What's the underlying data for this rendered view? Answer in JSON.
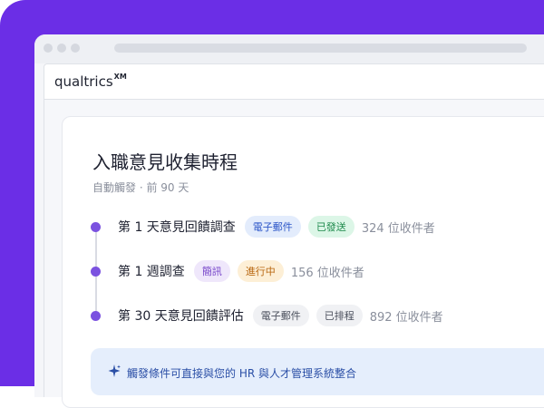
{
  "app": {
    "logo_text": "qualtrics",
    "logo_mark": "XM"
  },
  "card": {
    "title": "入職意見收集時程",
    "subtitle": "自動觸發 · 前 90 天"
  },
  "steps": [
    {
      "label": "第 1 天意見回饋調查",
      "tags": [
        {
          "text": "電子郵件",
          "style": "blue"
        },
        {
          "text": "已發送",
          "style": "green"
        }
      ],
      "count": "324 位收件者"
    },
    {
      "label": "第 1 週調查",
      "tags": [
        {
          "text": "簡訊",
          "style": "purple"
        },
        {
          "text": "進行中",
          "style": "orange"
        }
      ],
      "count": "156 位收件者"
    },
    {
      "label": "第 30 天意見回饋評估",
      "tags": [
        {
          "text": "電子郵件",
          "style": "gray"
        },
        {
          "text": "已排程",
          "style": "gray"
        }
      ],
      "count": "892 位收件者"
    }
  ],
  "banner": {
    "icon": "sparkle-icon",
    "text": "觸發條件可直接與您的 HR 與人才管理系統整合"
  },
  "colors": {
    "background": "#6b2ee6",
    "bullet": "#7b52e0",
    "banner_bg": "#e5eefc",
    "banner_text": "#2b4fa6"
  }
}
